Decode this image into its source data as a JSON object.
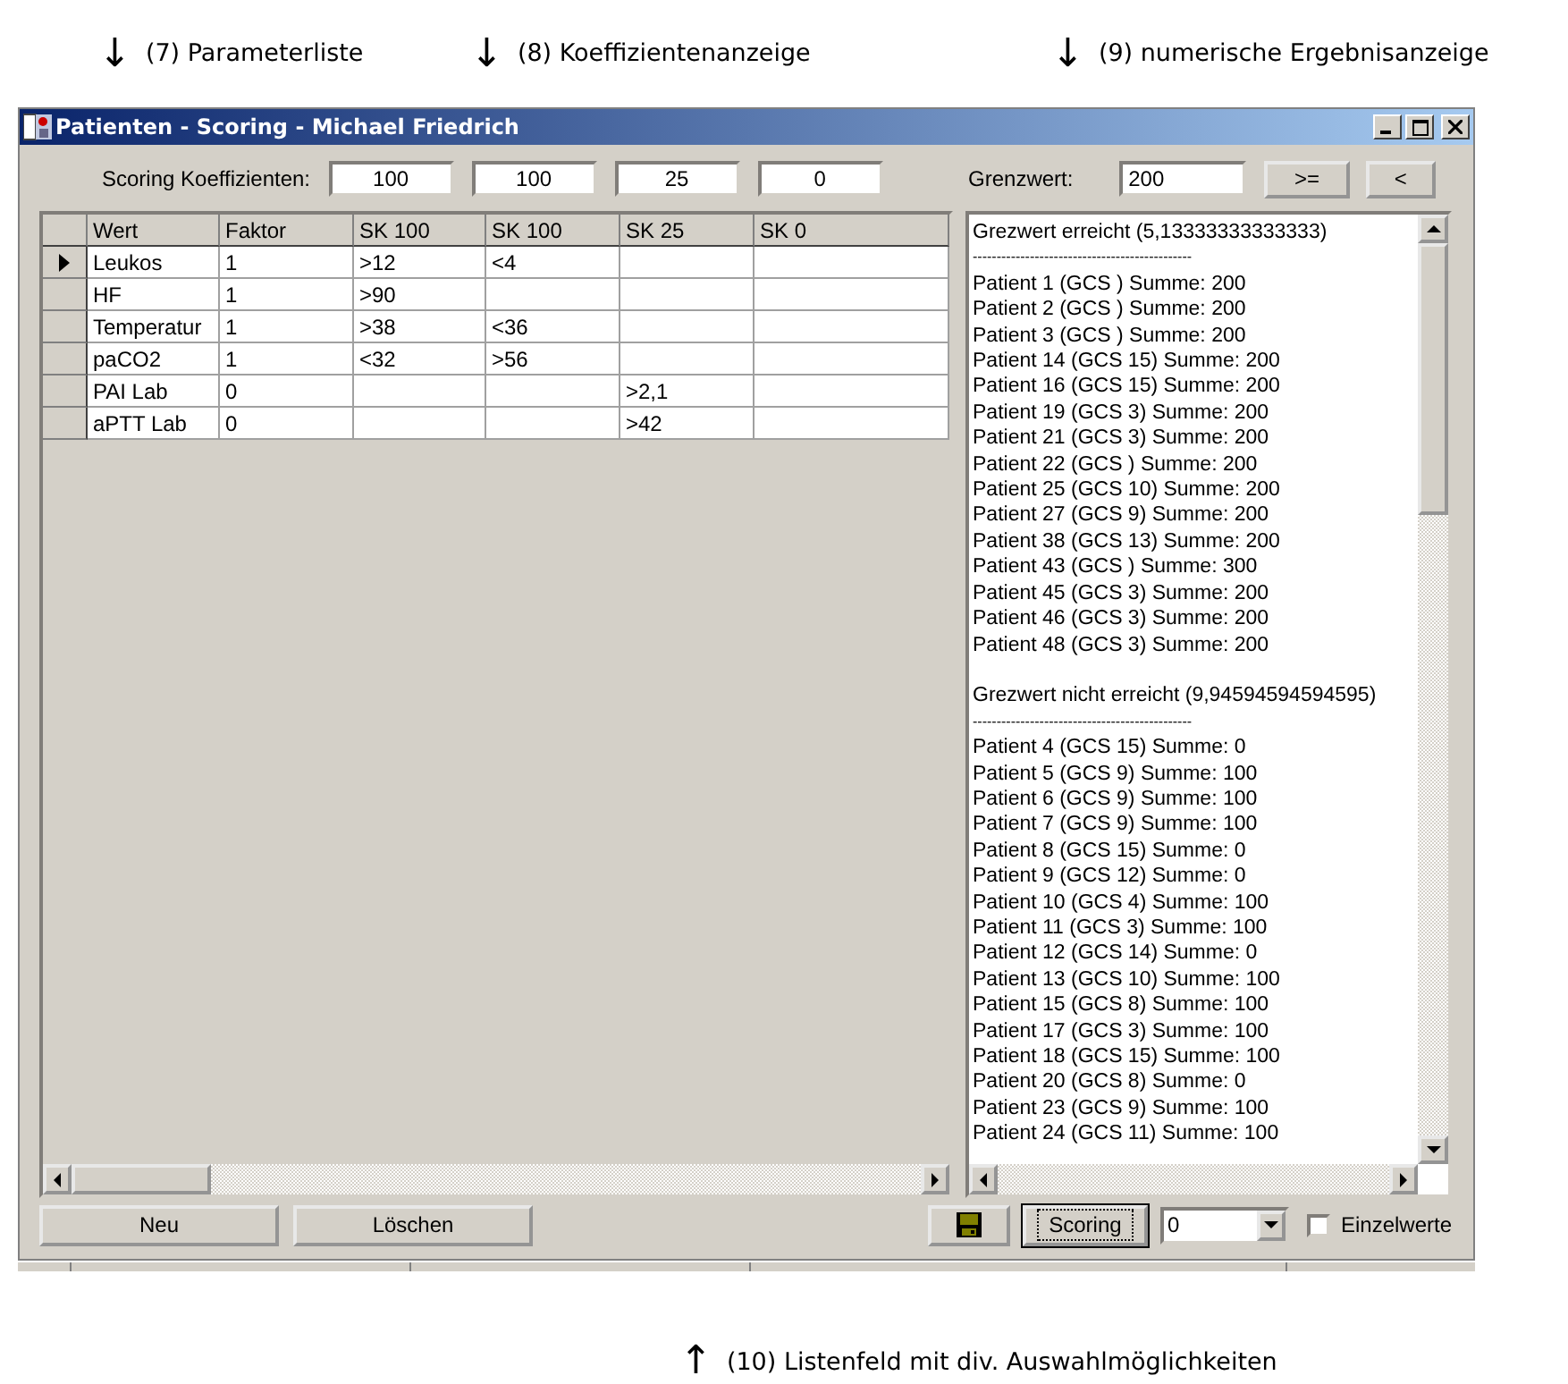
{
  "annotations_top": [
    {
      "arrow": "↓",
      "text": "(7) Parameterliste"
    },
    {
      "arrow": "↓",
      "text": "(8) Koeffizientenanzeige"
    },
    {
      "arrow": "↓",
      "text": "(9) numerische Ergebnisanzeige"
    }
  ],
  "window": {
    "title": "Patienten - Scoring - Michael Friedrich"
  },
  "coefficients": {
    "label": "Scoring Koeffizienten:",
    "values": [
      "100",
      "100",
      "25",
      "0"
    ]
  },
  "threshold": {
    "label": "Grenzwert:",
    "value": "200",
    "buttons": [
      ">=",
      "<"
    ]
  },
  "grid": {
    "columns": [
      "Wert",
      "Faktor",
      "SK 100",
      "SK 100",
      "SK 25",
      "SK 0"
    ],
    "rows": [
      {
        "selected": true,
        "cells": [
          "Leukos",
          "1",
          ">12",
          "<4",
          "",
          ""
        ]
      },
      {
        "selected": false,
        "cells": [
          "HF",
          "1",
          ">90",
          "",
          "",
          ""
        ]
      },
      {
        "selected": false,
        "cells": [
          "Temperatur",
          "1",
          ">38",
          "<36",
          "",
          ""
        ]
      },
      {
        "selected": false,
        "cells": [
          "paCO2",
          "1",
          "<32",
          ">56",
          "",
          ""
        ]
      },
      {
        "selected": false,
        "cells": [
          "PAI Lab",
          "0",
          "",
          "",
          ">2,1",
          ""
        ]
      },
      {
        "selected": false,
        "cells": [
          "aPTT Lab",
          "0",
          "",
          "",
          ">42",
          ""
        ]
      }
    ]
  },
  "results": [
    {
      "heading": "Grezwert erreicht (5,13333333333333)",
      "separator": "----------------------------------------------",
      "lines": [
        "Patient 1 (GCS ) Summe: 200",
        "Patient 2 (GCS ) Summe: 200",
        "Patient 3 (GCS ) Summe: 200",
        "Patient 14 (GCS 15) Summe: 200",
        "Patient 16 (GCS 15) Summe: 200",
        "Patient 19 (GCS 3) Summe: 200",
        "Patient 21 (GCS 3) Summe: 200",
        "Patient 22 (GCS ) Summe: 200",
        "Patient 25 (GCS 10) Summe: 200",
        "Patient 27 (GCS 9) Summe: 200",
        "Patient 38 (GCS 13) Summe: 200",
        "Patient 43 (GCS ) Summe: 300",
        "Patient 45 (GCS 3) Summe: 200",
        "Patient 46 (GCS 3) Summe: 200",
        "Patient 48 (GCS 3) Summe: 200"
      ]
    },
    {
      "heading": "Grezwert nicht erreicht (9,94594594594595)",
      "separator": "----------------------------------------------",
      "lines": [
        "Patient 4 (GCS 15) Summe: 0",
        "Patient 5 (GCS 9) Summe: 100",
        "Patient 6 (GCS 9) Summe: 100",
        "Patient 7 (GCS 9) Summe: 100",
        "Patient 8 (GCS 15) Summe: 0",
        "Patient 9 (GCS 12) Summe: 0",
        "Patient 10 (GCS 4) Summe: 100",
        "Patient 11 (GCS 3) Summe: 100",
        "Patient 12 (GCS 14) Summe: 0",
        "Patient 13 (GCS 10) Summe: 100",
        "Patient 15 (GCS 8) Summe: 100",
        "Patient 17 (GCS 3) Summe: 100",
        "Patient 18 (GCS 15) Summe: 100",
        "Patient 20 (GCS 8) Summe: 0",
        "Patient 23 (GCS 9) Summe: 100",
        "Patient 24 (GCS 11) Summe: 100"
      ]
    }
  ],
  "bottom_buttons": [
    "Neu",
    "Löschen"
  ],
  "scoring_button": "Scoring",
  "combo": {
    "value": "0"
  },
  "checkbox": {
    "label": "Einzelwerte",
    "checked": false
  },
  "annotation_bottom": {
    "arrow": "↑",
    "text": "(10) Listenfeld mit div. Auswahlmöglichkeiten"
  }
}
